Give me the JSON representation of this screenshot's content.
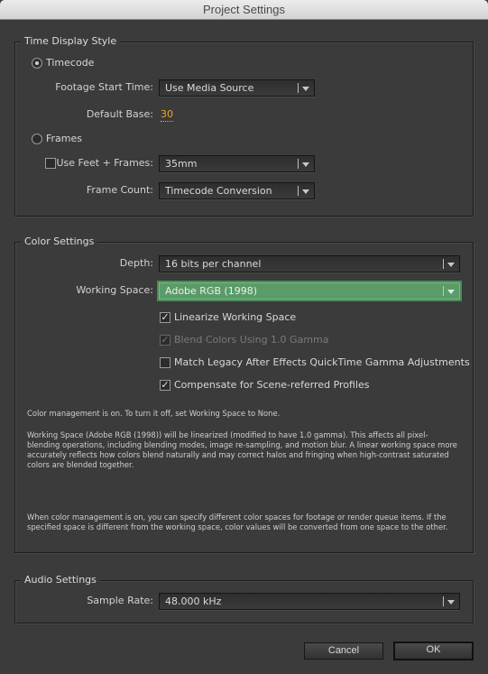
{
  "window": {
    "title": "Project Settings"
  },
  "time_display": {
    "title": "Time Display Style",
    "timecode_label": "Timecode",
    "timecode_selected": true,
    "footage_start_label": "Footage Start Time:",
    "footage_start_value": "Use Media Source",
    "default_base_label": "Default Base:",
    "default_base_value": "30",
    "frames_label": "Frames",
    "frames_selected": false,
    "feet_frames_label": "Use Feet + Frames:",
    "feet_frames_checked": false,
    "feet_frames_value": "35mm",
    "frame_count_label": "Frame Count:",
    "frame_count_value": "Timecode Conversion"
  },
  "color": {
    "title": "Color Settings",
    "depth_label": "Depth:",
    "depth_value": "16 bits per channel",
    "working_space_label": "Working Space:",
    "working_space_value": "Adobe RGB (1998)",
    "checkboxes": [
      {
        "label": "Linearize Working Space",
        "checked": true,
        "enabled": true
      },
      {
        "label": "Blend Colors Using 1.0 Gamma",
        "checked": true,
        "enabled": false
      },
      {
        "label": "Match Legacy After Effects QuickTime Gamma Adjustments",
        "checked": false,
        "enabled": true
      },
      {
        "label": "Compensate for Scene-referred Profiles",
        "checked": true,
        "enabled": true
      }
    ],
    "info_1": "Color management is on. To turn it off, set Working Space to None.",
    "info_2": "Working Space (Adobe RGB (1998)) will be linearized (modified to have 1.0 gamma). This affects all pixel-blending operations, including blending modes, image re-sampling, and motion blur. A linear working space more accurately reflects how colors blend naturally and may correct halos and fringing when high-contrast saturated colors are blended together.",
    "info_3": "When color management is on, you can specify different color spaces for footage or render queue items. If the specified space is different from the working space, color values will be converted from one space to the other."
  },
  "audio": {
    "title": "Audio Settings",
    "sample_rate_label": "Sample Rate:",
    "sample_rate_value": "48.000 kHz"
  },
  "buttons": {
    "cancel": "Cancel",
    "ok": "OK"
  },
  "colors": {
    "accent_green": "#5b9b6a",
    "link_orange": "#e8a628",
    "background": "#3b3b3b"
  }
}
